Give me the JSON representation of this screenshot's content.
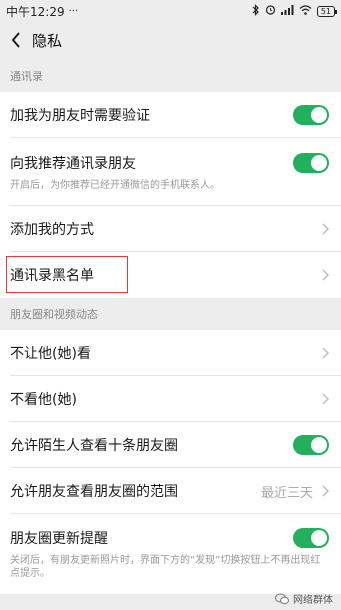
{
  "statusbar": {
    "time": "中午12:29",
    "icons": [
      "ellipsis-icon",
      "bluetooth-icon",
      "alarm-icon",
      "signal-icon",
      "wifi-icon",
      "battery-icon"
    ],
    "battery": "51"
  },
  "navbar": {
    "title": "隐私"
  },
  "sections": {
    "contacts": {
      "header": "通讯录",
      "verify": "加我为朋友时需要验证",
      "recommend": "向我推荐通讯录朋友",
      "recommend_sub": "开启后，为你推荐已经开通微信的手机联系人。",
      "add_methods": "添加我的方式",
      "blacklist": "通讯录黑名单"
    },
    "moments": {
      "header": "朋友圈和视频动态",
      "hide_from": "不让他(她)看",
      "dont_see": "不看他(她)",
      "allow_strangers": "允许陌生人查看十条朋友圈",
      "visible_range": "允许朋友查看朋友圈的范围",
      "visible_range_value": "最近三天",
      "update_reminder": "朋友圈更新提醒",
      "update_reminder_sub": "关闭后，有朋友更新照片时，界面下方的“发现”切换按钮上不再出现红点提示。"
    }
  },
  "watermark": "网络群体",
  "colors": {
    "toggle_on": "#21b05c",
    "highlight": "#e03b3b",
    "background": "#ededed"
  }
}
